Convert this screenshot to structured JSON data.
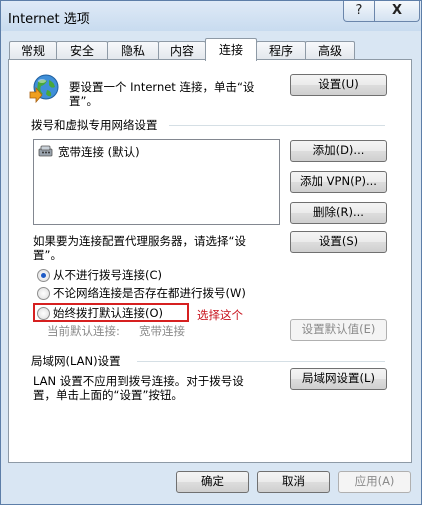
{
  "window": {
    "title": "Internet 选项",
    "help_label": "?",
    "close_label": "X"
  },
  "tabs": [
    {
      "label": "常规"
    },
    {
      "label": "安全"
    },
    {
      "label": "隐私"
    },
    {
      "label": "内容"
    },
    {
      "label": "连接",
      "active": true
    },
    {
      "label": "程序"
    },
    {
      "label": "高级"
    }
  ],
  "setup": {
    "text_line1": "要设置一个 Internet 连接，单击“设",
    "text_line2": "置”。",
    "button": "设置(U)"
  },
  "dialup_section": {
    "heading": "拨号和虚拟专用网络设置",
    "connections": [
      {
        "label": "宽带连接 (默认)"
      }
    ],
    "add_button": "添加(D)...",
    "add_vpn_button": "添加 VPN(P)...",
    "remove_button": "删除(R)...",
    "proxy_text_line1": "如果要为连接配置代理服务器，请选择“设",
    "proxy_text_line2": "置”。",
    "settings_button": "设置(S)",
    "options": [
      {
        "label": "从不进行拨号连接(C)",
        "checked": true
      },
      {
        "label": "不论网络连接是否存在都进行拨号(W)",
        "checked": false
      },
      {
        "label": "始终拨打默认连接(O)",
        "checked": false
      }
    ],
    "annotation": "选择这个",
    "current_default_label": "当前默认连接:",
    "current_default_value": "宽带连接",
    "set_default_button": "设置默认值(E)"
  },
  "lan_section": {
    "heading": "局域网(LAN)设置",
    "text_line1": "LAN 设置不应用到拨号连接。对于拨号设",
    "text_line2": "置，单击上面的“设置”按钮。",
    "button": "局域网设置(L)"
  },
  "footer": {
    "ok_button": "确定",
    "cancel_button": "取消",
    "apply_button": "应用(A)"
  }
}
